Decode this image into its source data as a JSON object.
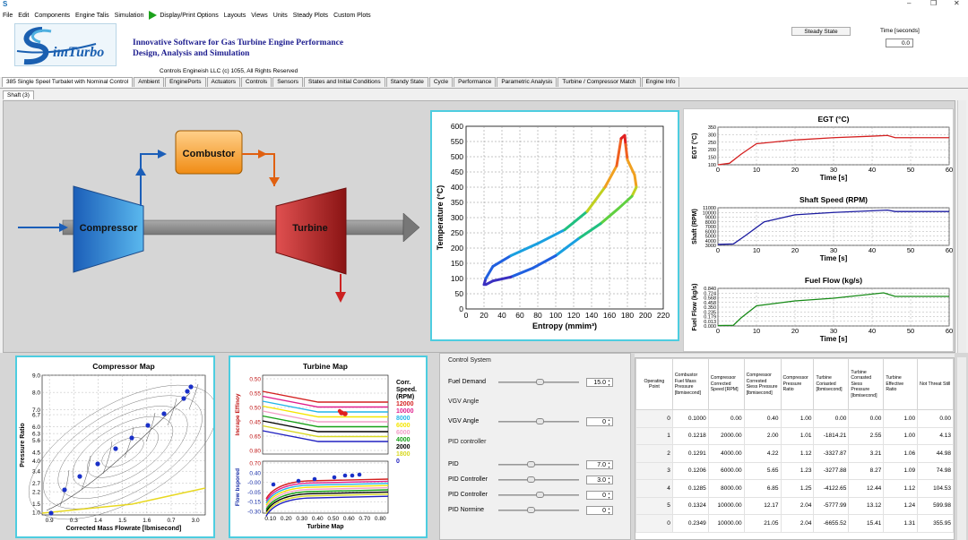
{
  "app": {
    "icon_letter": "S"
  },
  "menu": {
    "items": [
      "File",
      "Edit",
      "Components",
      "Engine Talis",
      "Simulation",
      "Display/Print Options",
      "Layouts",
      "Views",
      "Units",
      "Steady Plots",
      "Custom Plots"
    ]
  },
  "header": {
    "tagline_1": "Innovative Software for Gas Turbine Engine Performance",
    "tagline_2": "Design, Analysis and Simulation",
    "copyright": "Controls Engineish LLC   (c) 1055,   All Rights Reserved",
    "logo_text": "imTurbo",
    "steady_state_button": "Steady State",
    "time_label": "Time [seconds]",
    "time_value": "0.0"
  },
  "tabs": [
    "385 Single Speel Turbalet with Nominal Control",
    "Ambient",
    "EnginePorts",
    "Actuators",
    "Controls",
    "Sensors",
    "States and Initial Conditions",
    "Standy State",
    "Cycle",
    "Performance",
    "Parametric Analysis",
    "Turbine / Compressor Match",
    "Engine Info"
  ],
  "subtab": "Shaft (3)",
  "diagram": {
    "compressor": "Compressor",
    "combustor": "Combustor",
    "turbine": "Turbine"
  },
  "ts_plot": {
    "xlabel": "Entropy (mmim³)",
    "ylabel": "Temperature (°C)",
    "xticks": [
      "0",
      "20",
      "40",
      "60",
      "80",
      "100",
      "120",
      "140",
      "160",
      "180",
      "200",
      "220"
    ],
    "yticks": [
      "0",
      "50",
      "100",
      "150",
      "200",
      "250",
      "300",
      "350",
      "400",
      "450",
      "500",
      "550",
      "600"
    ]
  },
  "egt_plot": {
    "title": "EGT (°C)",
    "ylabel": "EGT (°C)",
    "xlabel": "Time [s]",
    "yticks": [
      "100",
      "150",
      "200",
      "250",
      "300",
      "350"
    ],
    "xticks": [
      "0",
      "10",
      "20",
      "30",
      "40",
      "50",
      "60"
    ]
  },
  "speed_plot": {
    "title": "Shaft Speed (RPM)",
    "ylabel": "Shaft (RPM)",
    "xlabel": "Time [s]",
    "yticks": [
      "3000",
      "4000",
      "5000",
      "6000",
      "7000",
      "8000",
      "9000",
      "10000",
      "11000"
    ],
    "xticks": [
      "0",
      "10",
      "20",
      "30",
      "40",
      "50",
      "60"
    ]
  },
  "fuel_plot": {
    "title": "Fuel Flow (kg/s)",
    "ylabel": "Fuel Flow (kg/s)",
    "xlabel": "Time [s]",
    "yticks": [
      "0.000",
      "0.013",
      "0.179",
      "0.235",
      "0.350",
      "0.458",
      "0.568",
      "0.724",
      "0.840"
    ],
    "xticks": [
      "0",
      "10",
      "20",
      "30",
      "40",
      "50",
      "60"
    ]
  },
  "compressor_map": {
    "title": "Compressor Map",
    "xlabel": "Corrected Mass Flowrate [lbmisecond]",
    "ylabel": "Pressure Ratio",
    "yticks": [
      "1.0",
      "1.5",
      "2.2",
      "2.7",
      "3.4",
      "4.0",
      "4.5",
      "5.6",
      "6.3",
      "6.0",
      "6.7",
      "7.0",
      "8.0",
      "9.0"
    ],
    "xticks": [
      "0.9",
      "0.3",
      "1.4",
      "1.5",
      "1.6",
      "0.7",
      "3.0"
    ]
  },
  "turbine_map": {
    "title": "Turbine Map",
    "xlabel": "Turbine Map",
    "ylabel_top": "Incrape Effinoy",
    "ylabel_bottom": "Flow bspored",
    "yticks_top": [
      "0.50",
      "0.55",
      "0.50",
      "0.45",
      "0.65",
      "0.80"
    ],
    "yticks_bottom": [
      "0.70",
      "0.40",
      "-0.00",
      "-0.05",
      "-0.15",
      "-0.30"
    ],
    "xticks": [
      "0.10",
      "0.20",
      "0.30",
      "0.40",
      "0.50",
      "0.60",
      "0.70",
      "0.80"
    ],
    "legend_title_1": "Corr.",
    "legend_title_2": "Speed.",
    "legend_title_3": "(RPM)",
    "legend": [
      {
        "label": "12000",
        "color": "#d42020"
      },
      {
        "label": "10000",
        "color": "#e01e8c"
      },
      {
        "label": "8000",
        "color": "#23b5e8"
      },
      {
        "label": "6000",
        "color": "#f5e600"
      },
      {
        "label": "6000",
        "color": "#f2a0c8"
      },
      {
        "label": "4000",
        "color": "#16a016"
      },
      {
        "label": "2000",
        "color": "#000000"
      },
      {
        "label": "1800",
        "color": "#d8d820"
      },
      {
        "label": "0",
        "color": "#2020c0"
      }
    ]
  },
  "controls": {
    "section1": "Control System",
    "fuel_label": "Fuel Demand",
    "fuel_value": "15.0",
    "section2": "VGV Angle",
    "vgv_label": "VGV Angle",
    "vgv_value": "0",
    "section3": "PID controller",
    "pid_label": "PID",
    "pid_value": "7.0",
    "pidc_label": "PID Controller",
    "pidc_value": "3.0",
    "pidc2_label": "PID Controller",
    "pidc2_value": "0",
    "pidn_label": "PID Normine",
    "pidn_value": "0"
  },
  "table": {
    "headers": [
      "Operating Point",
      "Combustor Fuel Mass Pressure [lbmisecond]",
      "Compressor Corrected Speed [RPM]",
      "Compressor Corrested Siess Pressure [lbmisecond]",
      "Compressor Pressure Ratio",
      "Turbine Coriasted [lbmisecond]",
      "Turbine Corrasted Siess Pressure [lbmisecond]",
      "Turbine Effective Ratio",
      "Not Threat Still"
    ],
    "rows": [
      [
        "0",
        "0.1000",
        "0.00",
        "0.40",
        "1.00",
        "0.00",
        "0.00",
        "1.00",
        "0.00"
      ],
      [
        "1",
        "0.1218",
        "2000.00",
        "2.00",
        "1.01",
        "-1814.21",
        "2.55",
        "1.00",
        "4.13"
      ],
      [
        "2",
        "0.1291",
        "4000.00",
        "4.22",
        "1.12",
        "-3327.87",
        "3.21",
        "1.06",
        "44.98"
      ],
      [
        "3",
        "0.1206",
        "6000.00",
        "5.65",
        "1.23",
        "-3277.88",
        "8.27",
        "1.09",
        "74.98"
      ],
      [
        "4",
        "0.1285",
        "8000.00",
        "6.85",
        "1.25",
        "-4122.65",
        "12.44",
        "1.12",
        "104.53"
      ],
      [
        "5",
        "0.1324",
        "10000.00",
        "12.17",
        "2.04",
        "-5777.99",
        "13.12",
        "1.24",
        "599.98"
      ],
      [
        "0",
        "0.2349",
        "10000.00",
        "21.05",
        "2.04",
        "-6655.52",
        "15.41",
        "1.31",
        "355.95"
      ]
    ]
  }
}
